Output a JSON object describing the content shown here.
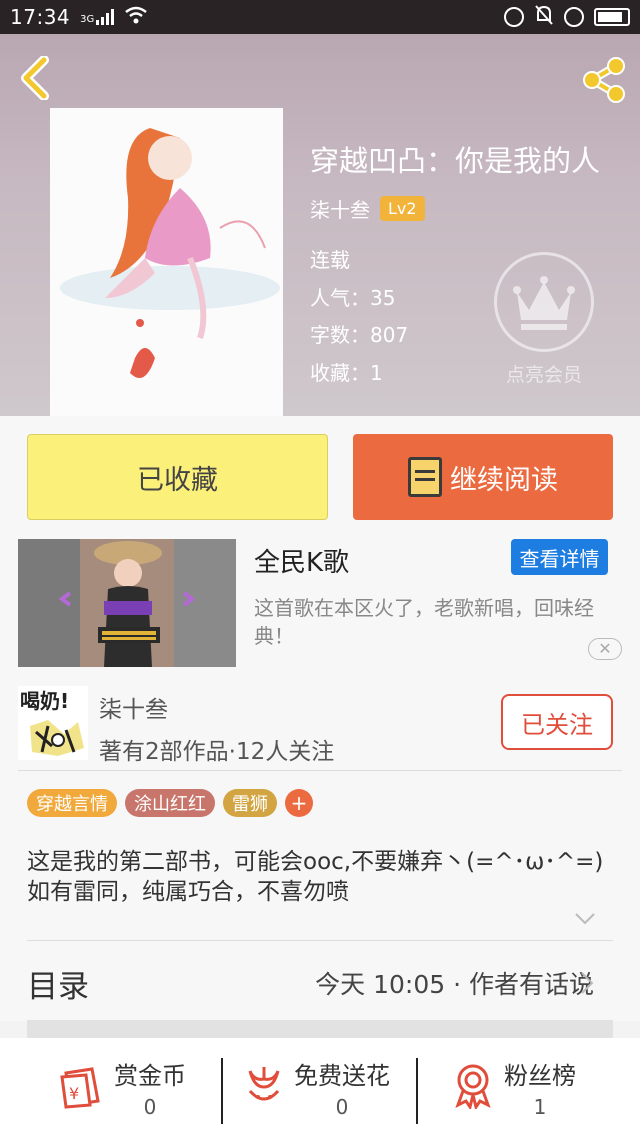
{
  "status_bar": {
    "time": "17:34",
    "network": "3G"
  },
  "book": {
    "title": "穿越凹凸：你是我的人",
    "author": "柒十叁",
    "level": "Lv2",
    "status": "连载",
    "popularity": "人气：35",
    "word_count": "字数：807",
    "favorites": "收藏：1",
    "vip_label": "点亮会员"
  },
  "actions": {
    "favorited_label": "已收藏",
    "continue_label": "继续阅读"
  },
  "ad": {
    "title": "全民K歌",
    "detail_button": "查看详情",
    "description": "这首歌在本区火了，老歌新唱，回味经典！",
    "close": "✕"
  },
  "author_card": {
    "avatar_text": "喝奶!",
    "name": "柒十叁",
    "stats": "著有2部作品·12人关注",
    "follow_label": "已关注"
  },
  "tags": [
    {
      "label": "穿越言情",
      "color": "#f2a93b"
    },
    {
      "label": "涂山红红",
      "color": "#c8766b"
    },
    {
      "label": "雷狮",
      "color": "#d2a542"
    }
  ],
  "tag_add": "+",
  "description": "这是我的第二部书，可能会ooc,不要嫌弃丶(=^･ω･^=)如有雷同，纯属巧合，不喜勿喷",
  "toc": {
    "title": "目录",
    "update": "今天 10:05 · 作者有话说"
  },
  "bottom_bar": [
    {
      "label": "赏金币",
      "value": "0",
      "icon": "coin-envelope-icon"
    },
    {
      "label": "免费送花",
      "value": "0",
      "icon": "flower-icon"
    },
    {
      "label": "粉丝榜",
      "value": "1",
      "icon": "medal-icon"
    }
  ]
}
